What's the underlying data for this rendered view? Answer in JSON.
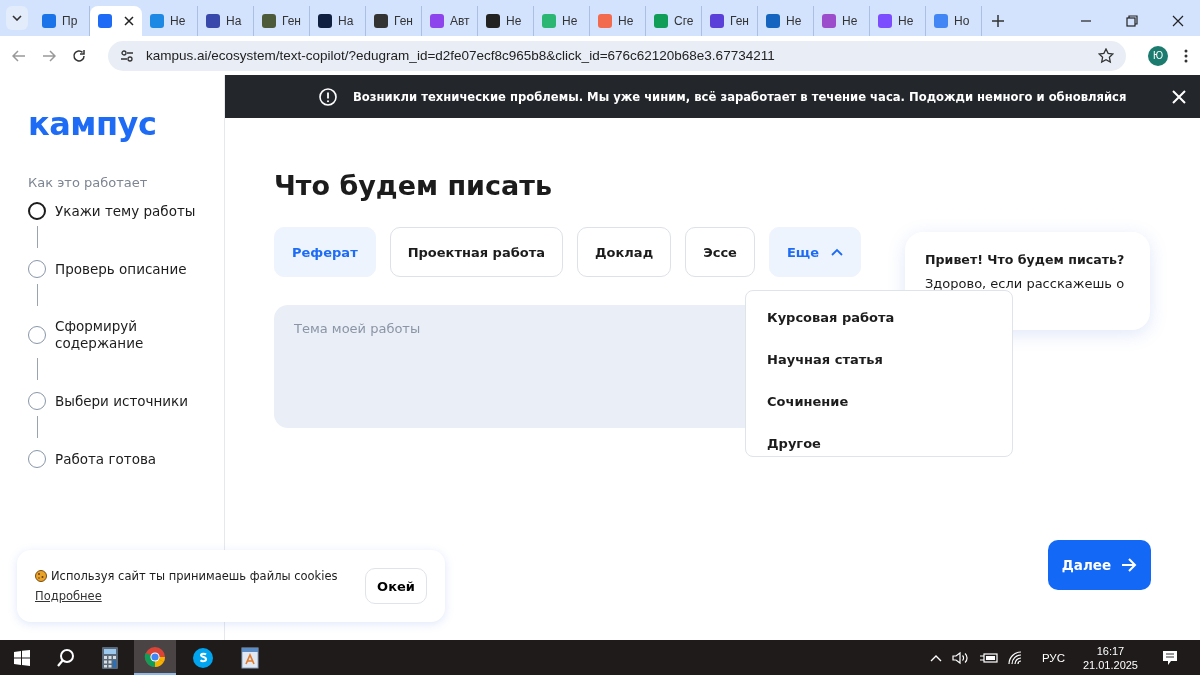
{
  "browser": {
    "tabs": [
      {
        "title": "Пр",
        "selected": false,
        "color": "#1a73e8"
      },
      {
        "selected": true,
        "color": "#1e6cf5"
      },
      {
        "title": "Не",
        "selected": false,
        "color": "#1e88e5"
      },
      {
        "title": "На",
        "selected": false,
        "color": "#3949ab"
      },
      {
        "title": "Ген",
        "selected": false,
        "color": "#4e5b3a"
      },
      {
        "title": "На",
        "selected": false,
        "color": "#102040"
      },
      {
        "title": "Ген",
        "selected": false,
        "color": "#333333"
      },
      {
        "title": "Авт",
        "selected": false,
        "color": "#8e44ec"
      },
      {
        "title": "Не",
        "selected": false,
        "color": "#222222"
      },
      {
        "title": "Не",
        "selected": false,
        "color": "#2bb673"
      },
      {
        "title": "Не",
        "selected": false,
        "color": "#f26b4e"
      },
      {
        "title": "Сге",
        "selected": false,
        "color": "#0f9d58"
      },
      {
        "title": "Ген",
        "selected": false,
        "color": "#5b3fd9"
      },
      {
        "title": "Не",
        "selected": false,
        "color": "#1565c0"
      },
      {
        "title": "Не",
        "selected": false,
        "color": "#9c4dcc"
      },
      {
        "title": "Не",
        "selected": false,
        "color": "#7c4dff"
      },
      {
        "title": "Но",
        "selected": false,
        "color": "#4285f4"
      }
    ],
    "url": "kampus.ai/ecosystem/text-copilot/?edugram_id=d2fe07ecf8c965b8&click_id=676c62120b68e3.67734211",
    "profile": "Ю"
  },
  "sidebar": {
    "logo": "кампус",
    "heading": "Как это работает",
    "steps": [
      {
        "label": "Укажи тему работы",
        "selected": true
      },
      {
        "label": "Проверь описание",
        "selected": false
      },
      {
        "label": "Сформируй содержание",
        "selected": false
      },
      {
        "label": "Выбери источники",
        "selected": false
      },
      {
        "label": "Работа готова",
        "selected": false
      }
    ]
  },
  "alert": {
    "text": "Возникли технические проблемы. Мы уже чиним, всё заработает в течение часа. Подожди немного и обновляйся"
  },
  "main": {
    "title": "Что будем писать",
    "types": [
      {
        "label": "Реферат",
        "selected": true
      },
      {
        "label": "Проектная работа",
        "selected": false
      },
      {
        "label": "Доклад",
        "selected": false
      },
      {
        "label": "Эссе",
        "selected": false
      }
    ],
    "more": {
      "label": "Еще",
      "expanded": true,
      "options": [
        "Курсовая работа",
        "Научная статья",
        "Сочинение",
        "Другое"
      ]
    },
    "topic": {
      "placeholder": "Тема моей работы"
    },
    "next_button": "Далее"
  },
  "assistant": {
    "title": "Привет! Что будем писать?",
    "text": "Здорово, если расскажешь о"
  },
  "cookies": {
    "text": "Используя сайт ты принимаешь файлы cookies",
    "link": "Подробнее",
    "button": "Окей"
  },
  "taskbar": {
    "language": "РУС",
    "time": "16:17",
    "date": "21.01.2025"
  }
}
